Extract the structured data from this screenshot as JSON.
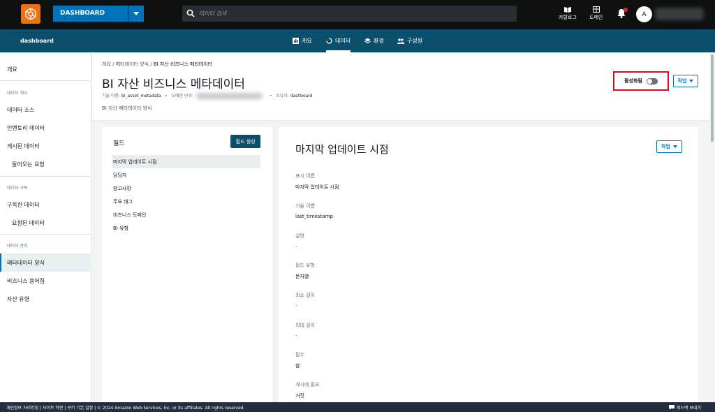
{
  "topbar": {
    "dashboard_label": "DASHBOARD",
    "search_placeholder": "데이터 검색",
    "catalog_label": "카탈로그",
    "domain_label": "도메인",
    "avatar_letter": "A"
  },
  "subnav": {
    "domain_name": "dashboard",
    "tabs": [
      {
        "label": "개요"
      },
      {
        "label": "데이터"
      },
      {
        "label": "환경"
      },
      {
        "label": "구성원"
      }
    ]
  },
  "sidebar": {
    "overview": "개요",
    "section_publish": "데이터 게시",
    "data_sources": "데이터 소스",
    "inventory": "인벤토리 데이터",
    "published": "게시된 데이터",
    "incoming": "들어오는 요청",
    "section_subscribe": "데이터 구독",
    "subscribed": "구독한 데이터",
    "requested": "요청된 데이터",
    "section_manage": "데이터 관리",
    "metadata_forms": "메타데이터 양식",
    "glossaries": "비즈니스 용어집",
    "asset_types": "자산 유형"
  },
  "header": {
    "breadcrumb": [
      "개요",
      "메타데이터 양식",
      "BI 자산 비즈니스 메타데이터"
    ],
    "title": "BI 자산 비즈니스 메타데이터",
    "tech_name_label": "기술 이름:",
    "tech_name": "bi_asset_metadata",
    "domain_unit_label": "도메인 단위:",
    "owner_label": "소유자:",
    "owner": "dashboard",
    "description": "BI 자산 메타데이터 양식",
    "enabled_label": "활성화됨",
    "action_label": "작업"
  },
  "fields": {
    "title": "필드",
    "create_label": "필드 생성",
    "items": [
      "마지막 업데이트 시점",
      "담당자",
      "참고사항",
      "주요 태그",
      "비즈니스 도메인",
      "BI 유형"
    ]
  },
  "detail": {
    "title": "마지막 업데이트 시점",
    "action_label": "작업",
    "props": [
      {
        "label": "표시 이름",
        "value": "마지막 업데이트 시점"
      },
      {
        "label": "기술 이름",
        "value": "last_timestamp"
      },
      {
        "label": "설명",
        "value": "-"
      },
      {
        "label": "필드 유형",
        "value": "문자열"
      },
      {
        "label": "최소 길이",
        "value": "-"
      },
      {
        "label": "최대 길이",
        "value": "-"
      },
      {
        "label": "필수",
        "value": "참"
      },
      {
        "label": "게시에 필요",
        "value": "거짓"
      }
    ]
  },
  "footer": {
    "links": "개인정보 처리방침  |  사이트 약관  |  쿠키 기본 설정  |  © 2024 Amazon Web Services, Inc. or its affiliates. All rights reserved.",
    "feedback": "피드백 보내기"
  },
  "colors": {
    "topbar": "#0f1111",
    "subnav": "#0b4f6c",
    "accent": "#0073bb",
    "logo": "#ec7211",
    "highlight_box": "#e3091a"
  }
}
